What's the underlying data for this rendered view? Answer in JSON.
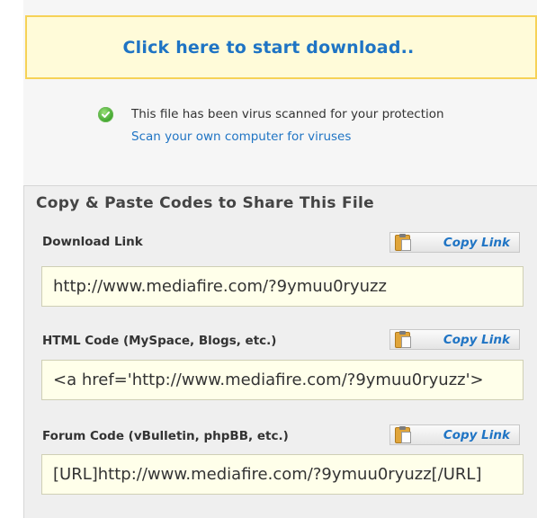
{
  "download": {
    "link_text": "Click here to start download.."
  },
  "scan": {
    "message": "This file has been virus scanned for your protection",
    "link_text": "Scan your own computer for viruses",
    "icon": "check-circle-icon"
  },
  "share": {
    "header": "Copy & Paste Codes to Share This File",
    "fields": [
      {
        "label": "Download Link",
        "button": "Copy Link",
        "value": "http://www.mediafire.com/?9ymuu0ryuzz"
      },
      {
        "label": "HTML Code (MySpace, Blogs, etc.)",
        "button": "Copy Link",
        "value": "<a href='http://www.mediafire.com/?9ymuu0ryuzz'>"
      },
      {
        "label": "Forum Code (vBulletin, phpBB, etc.)",
        "button": "Copy Link",
        "value": "[URL]http://www.mediafire.com/?9ymuu0ryuzz[/URL]"
      }
    ]
  },
  "colors": {
    "link_blue": "#1f74c4",
    "download_box_bg": "#fffbd9",
    "download_box_border": "#f6d257",
    "code_box_bg": "#ffffea"
  }
}
